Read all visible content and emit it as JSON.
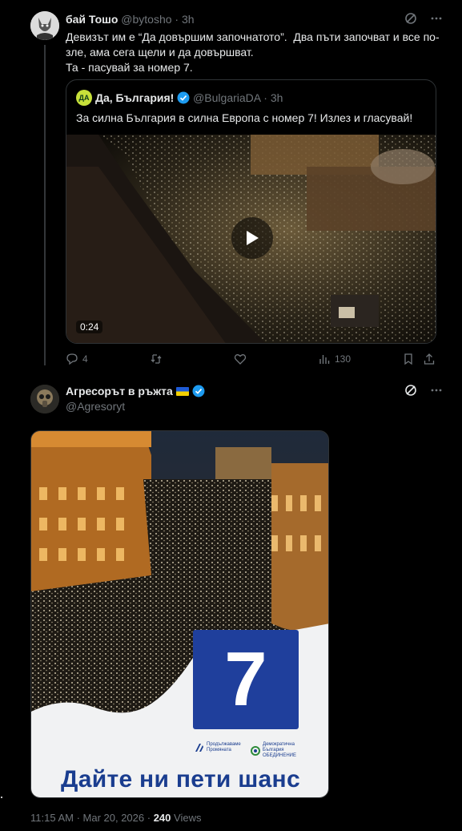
{
  "reply": {
    "name": "бай Тошо",
    "handle": "@bytosho",
    "time": "3h",
    "lines": [
      "Девизът им е “Да довършим започнатото”.  Два пъти започват и все по-",
      "зле, ама сега щели и да довършват.",
      "Та - пасувай за номер 7."
    ],
    "icons": [
      "grok-icon",
      "more-icon"
    ]
  },
  "quote": {
    "avatar_text": "ДА",
    "name": "Да, България!",
    "handle": "@BulgariaDA",
    "time": "3h",
    "text": "За силна България в силна Европа с номер 7! Излез и гласувай!",
    "video_duration": "0:24"
  },
  "actions": {
    "replies": "4",
    "retweets": "",
    "likes": "",
    "views": "130"
  },
  "main": {
    "name": "Агресорът в ръжта",
    "handle": "@Agresoryt",
    "poster": {
      "number": "7",
      "slogan": "Дайте ни пети шанс",
      "logo1_line1": "Продължаваме",
      "logo1_line2": "Промяната",
      "logo2_line1": "Демократична",
      "logo2_line2": "България",
      "logo2_line3": "ОБЕДИНЕНИЕ"
    },
    "timestamp": "11:15 AM · Mar 20, 2026 ·",
    "views_count": "240",
    "views_label": "Views"
  },
  "colors": {
    "background": "#000000",
    "text": "#e7e9ea",
    "muted": "#71767b",
    "verified": "#1d9bf0",
    "poster_blue": "#1f3f9c"
  }
}
